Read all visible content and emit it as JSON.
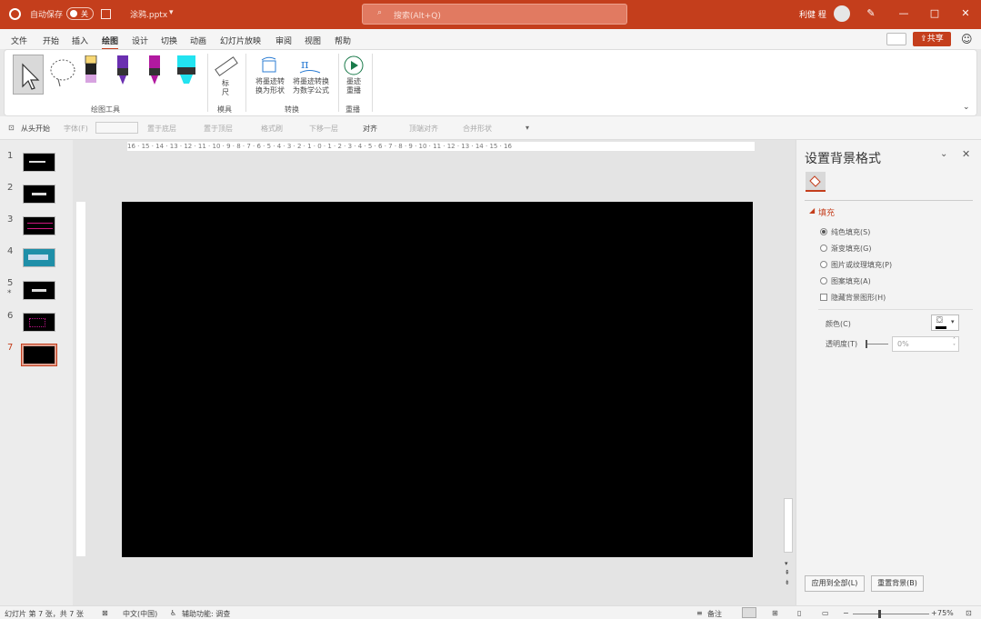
{
  "titlebar": {
    "autosave_label": "自动保存",
    "autosave_state": "关",
    "filename": "涂鸦.pptx",
    "search_placeholder": "搜索(Alt+Q)",
    "user_name": "利健 程"
  },
  "menu": [
    "文件",
    "开始",
    "插入",
    "绘图",
    "设计",
    "切换",
    "动画",
    "幻灯片放映",
    "审阅",
    "视图",
    "帮助"
  ],
  "share_label": "共享",
  "ribbon": {
    "group_drawing_tools": "绘图工具",
    "ruler_label_1": "标",
    "ruler_label_2": "尺",
    "group_stencils": "模具",
    "ink_to_shape_1": "将墨迹转",
    "ink_to_shape_2": "换为形状",
    "ink_to_math_1": "将墨迹转换",
    "ink_to_math_2": "为数学公式",
    "group_convert": "转换",
    "replay_1": "墨迹",
    "replay_2": "重播",
    "group_replay": "重播"
  },
  "quick": {
    "from_start": "从头开始",
    "font": "字体(F)",
    "bring_back": "置于底层",
    "bring_front": "置于顶层",
    "format_painter": "格式刷",
    "move_down": "下移一层",
    "align": "对齐",
    "top_align": "顶端对齐",
    "merge_shapes": "合并形状"
  },
  "ruler_text": "16 · 15 · 14 · 13 · 12 · 11 · 10 · 9 · 8 · 7 · 6 · 5 · 4 · 3 · 2 · 1 · 0 · 1 · 2 · 3 · 4 · 5 · 6 · 7 · 8 · 9 · 10 · 11 · 12 · 13 · 14 · 15 · 16",
  "slides": [
    {
      "num": "1",
      "star": ""
    },
    {
      "num": "2",
      "star": ""
    },
    {
      "num": "3",
      "star": ""
    },
    {
      "num": "4",
      "star": ""
    },
    {
      "num": "5",
      "star": "*"
    },
    {
      "num": "6",
      "star": ""
    },
    {
      "num": "7",
      "star": ""
    }
  ],
  "panel": {
    "title": "设置背景格式",
    "section": "填充",
    "options": [
      "纯色填充(S)",
      "渐变填充(G)",
      "图片或纹理填充(P)",
      "图案填充(A)"
    ],
    "hide_bg": "隐藏背景图形(H)",
    "color_label": "颜色(C)",
    "transparency_label": "透明度(T)",
    "transparency_value": "0%",
    "apply_all": "应用到全部(L)",
    "reset_bg": "重置背景(B)"
  },
  "status": {
    "slide_info": "幻灯片 第 7 张，共 7 张",
    "language": "中文(中国)",
    "accessibility": "辅助功能: 调查",
    "notes": "备注",
    "zoom": "75%"
  },
  "colors": {
    "accent": "#c43e1c",
    "slide_bg": "#000000"
  }
}
